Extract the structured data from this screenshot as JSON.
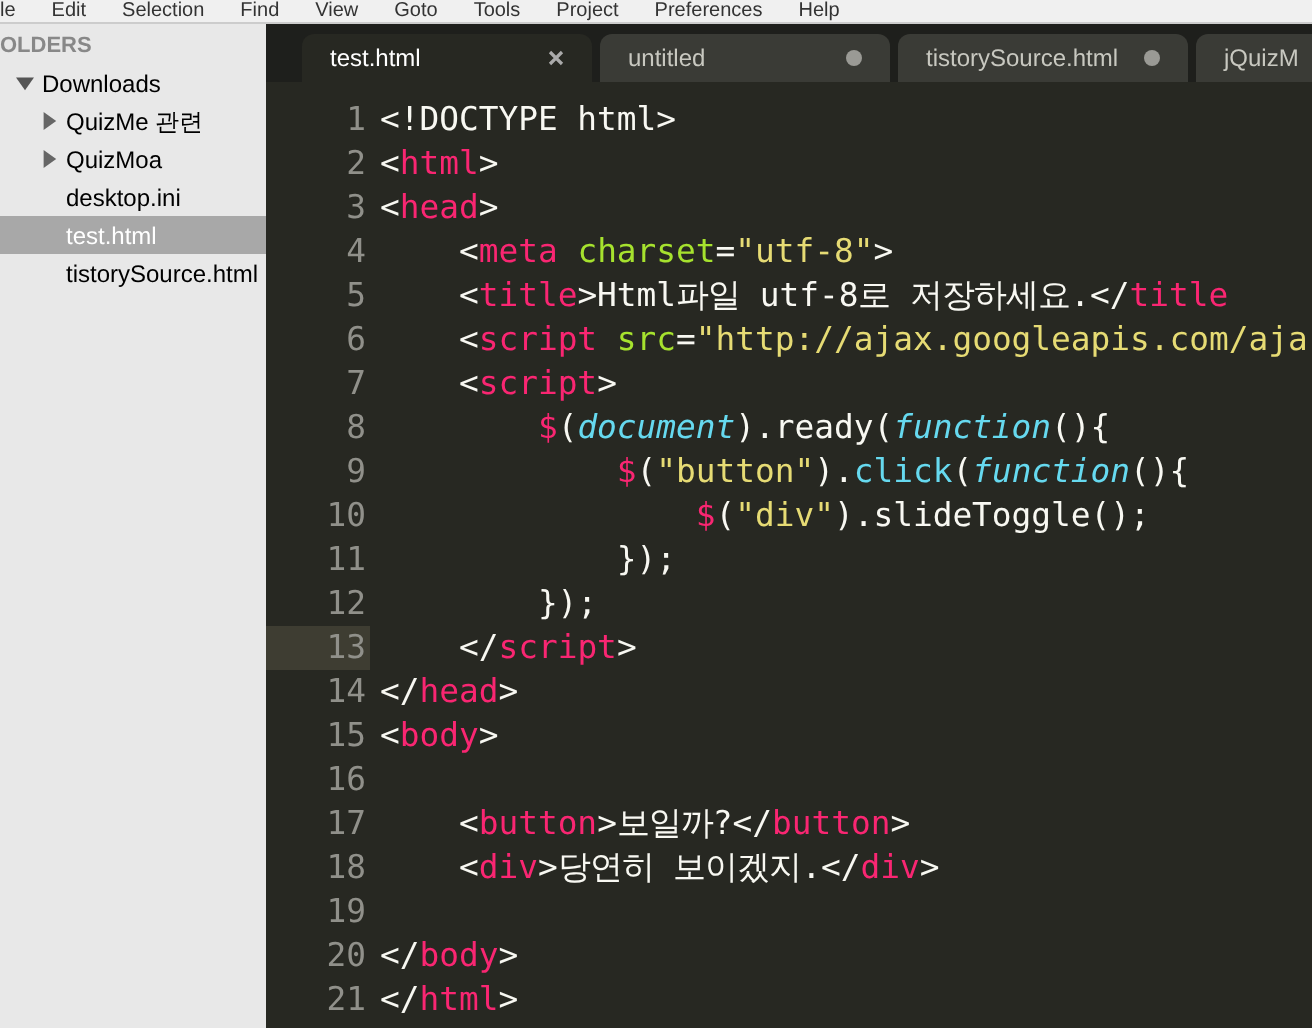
{
  "menu": [
    "le",
    "Edit",
    "Selection",
    "Find",
    "View",
    "Goto",
    "Tools",
    "Project",
    "Preferences",
    "Help"
  ],
  "sidebar": {
    "header": "OLDERS",
    "tree": [
      {
        "label": "Downloads",
        "kind": "folder",
        "expanded": true,
        "selected": false,
        "children": [
          {
            "label": "QuizMe 관련",
            "kind": "folder",
            "expanded": false,
            "selected": false
          },
          {
            "label": "QuizMoa",
            "kind": "folder",
            "expanded": false,
            "selected": false
          },
          {
            "label": "desktop.ini",
            "kind": "file",
            "selected": false
          },
          {
            "label": "test.html",
            "kind": "file",
            "selected": true
          },
          {
            "label": "tistorySource.html",
            "kind": "file",
            "selected": false
          }
        ]
      }
    ]
  },
  "tabs": [
    {
      "label": "test.html",
      "selected": true,
      "modified": false
    },
    {
      "label": "untitled",
      "selected": false,
      "modified": true
    },
    {
      "label": "tistorySource.html",
      "selected": false,
      "modified": true
    },
    {
      "label": "jQuizM",
      "selected": false
    }
  ],
  "editor": {
    "lines": [
      {
        "number": "1",
        "current": false,
        "tokens": [
          {
            "kind": "plain",
            "text": "<!DOCTYPE html>"
          }
        ]
      },
      {
        "number": "2",
        "current": false,
        "tokens": [
          {
            "kind": "plain",
            "text": "<"
          },
          {
            "kind": "tag",
            "text": "html"
          },
          {
            "kind": "plain",
            "text": ">"
          }
        ]
      },
      {
        "number": "3",
        "current": false,
        "tokens": [
          {
            "kind": "plain",
            "text": "<"
          },
          {
            "kind": "tag",
            "text": "head"
          },
          {
            "kind": "plain",
            "text": ">"
          }
        ]
      },
      {
        "number": "4",
        "current": false,
        "tokens": [
          {
            "kind": "plain",
            "text": "    <"
          },
          {
            "kind": "tag",
            "text": "meta"
          },
          {
            "kind": "attr",
            "text": " charset"
          },
          {
            "kind": "plain",
            "text": "="
          },
          {
            "kind": "string",
            "text": "\"utf-8\""
          },
          {
            "kind": "plain",
            "text": ">"
          }
        ]
      },
      {
        "number": "5",
        "current": false,
        "tokens": [
          {
            "kind": "plain",
            "text": "    <"
          },
          {
            "kind": "tag",
            "text": "title"
          },
          {
            "kind": "plain",
            "text": ">Html파일 utf-8로 저장하세요.</"
          },
          {
            "kind": "tag",
            "text": "title"
          }
        ]
      },
      {
        "number": "6",
        "current": false,
        "tokens": [
          {
            "kind": "plain",
            "text": "    <"
          },
          {
            "kind": "tag",
            "text": "script"
          },
          {
            "kind": "attr",
            "text": " src"
          },
          {
            "kind": "plain",
            "text": "="
          },
          {
            "kind": "string",
            "text": "\"http://ajax.googleapis.com/aja"
          }
        ]
      },
      {
        "number": "7",
        "current": false,
        "tokens": [
          {
            "kind": "plain",
            "text": "    <"
          },
          {
            "kind": "tag",
            "text": "script"
          },
          {
            "kind": "plain",
            "text": ">"
          }
        ]
      },
      {
        "number": "8",
        "current": false,
        "tokens": [
          {
            "kind": "tag",
            "text": "        $"
          },
          {
            "kind": "plain",
            "text": "("
          },
          {
            "kind": "italic",
            "text": "document"
          },
          {
            "kind": "plain",
            "text": ").ready("
          },
          {
            "kind": "italic",
            "text": "function"
          },
          {
            "kind": "plain",
            "text": "(){"
          }
        ]
      },
      {
        "number": "9",
        "current": false,
        "tokens": [
          {
            "kind": "tag",
            "text": "            $"
          },
          {
            "kind": "plain",
            "text": "("
          },
          {
            "kind": "string",
            "text": "\"button\""
          },
          {
            "kind": "plain",
            "text": ")."
          },
          {
            "kind": "call",
            "text": "click"
          },
          {
            "kind": "plain",
            "text": "("
          },
          {
            "kind": "italic",
            "text": "function"
          },
          {
            "kind": "plain",
            "text": "(){"
          }
        ]
      },
      {
        "number": "10",
        "current": false,
        "tokens": [
          {
            "kind": "tag",
            "text": "                $"
          },
          {
            "kind": "plain",
            "text": "("
          },
          {
            "kind": "string",
            "text": "\"div\""
          },
          {
            "kind": "plain",
            "text": ").slideToggle();"
          }
        ]
      },
      {
        "number": "11",
        "current": false,
        "tokens": [
          {
            "kind": "plain",
            "text": "            });"
          }
        ]
      },
      {
        "number": "12",
        "current": false,
        "tokens": [
          {
            "kind": "plain",
            "text": "        });"
          }
        ]
      },
      {
        "number": "13",
        "current": true,
        "tokens": [
          {
            "kind": "plain",
            "text": "    </"
          },
          {
            "kind": "tag",
            "text": "script"
          },
          {
            "kind": "plain",
            "text": ">"
          }
        ]
      },
      {
        "number": "14",
        "current": false,
        "tokens": [
          {
            "kind": "plain",
            "text": "</"
          },
          {
            "kind": "tag",
            "text": "head"
          },
          {
            "kind": "plain",
            "text": ">"
          }
        ]
      },
      {
        "number": "15",
        "current": false,
        "tokens": [
          {
            "kind": "plain",
            "text": "<"
          },
          {
            "kind": "tag",
            "text": "body"
          },
          {
            "kind": "plain",
            "text": ">"
          }
        ]
      },
      {
        "number": "16",
        "current": false
      },
      {
        "number": "17",
        "current": false,
        "tokens": [
          {
            "kind": "plain",
            "text": "    <"
          },
          {
            "kind": "tag",
            "text": "button"
          },
          {
            "kind": "plain",
            "text": ">보일까?</"
          },
          {
            "kind": "tag",
            "text": "button"
          },
          {
            "kind": "plain",
            "text": ">"
          }
        ]
      },
      {
        "number": "18",
        "current": false,
        "tokens": [
          {
            "kind": "plain",
            "text": "    <"
          },
          {
            "kind": "tag",
            "text": "div"
          },
          {
            "kind": "plain",
            "text": ">당연히 보이겠지.</"
          },
          {
            "kind": "tag",
            "text": "div"
          },
          {
            "kind": "plain",
            "text": ">"
          }
        ]
      },
      {
        "number": "19",
        "current": false
      },
      {
        "number": "20",
        "current": false,
        "tokens": [
          {
            "kind": "plain",
            "text": "</"
          },
          {
            "kind": "tag",
            "text": "body"
          },
          {
            "kind": "plain",
            "text": ">"
          }
        ]
      },
      {
        "number": "21",
        "current": false,
        "tokens": [
          {
            "kind": "plain",
            "text": "</"
          },
          {
            "kind": "tag",
            "text": "html"
          },
          {
            "kind": "plain",
            "text": ">"
          }
        ]
      }
    ]
  }
}
